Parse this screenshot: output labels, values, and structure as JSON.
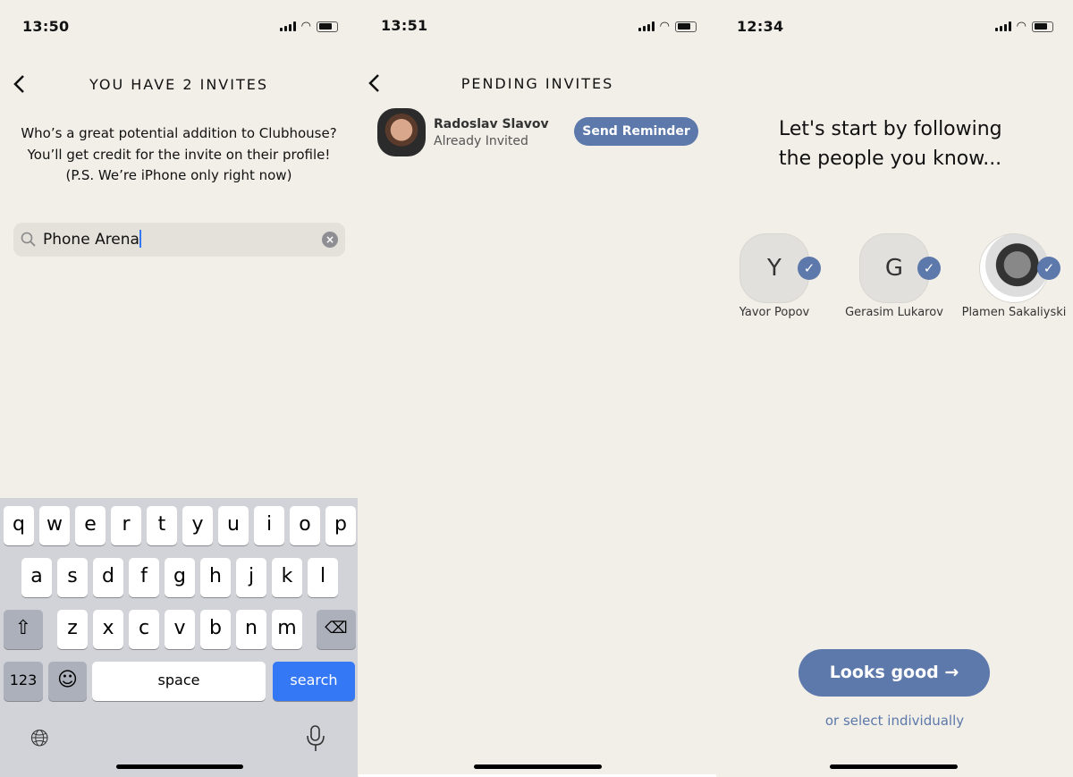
{
  "screen1": {
    "time": "13:50",
    "title": "YOU HAVE 2 INVITES",
    "description": [
      "Who’s a great potential addition to Clubhouse?",
      "You’ll get credit for the invite on their profile!",
      "(P.S. We’re iPhone only right now)"
    ],
    "search_value": "Phone Arena",
    "keyboard": {
      "row1": [
        "q",
        "w",
        "e",
        "r",
        "t",
        "y",
        "u",
        "i",
        "o",
        "p"
      ],
      "row2": [
        "a",
        "s",
        "d",
        "f",
        "g",
        "h",
        "j",
        "k",
        "l"
      ],
      "row3": [
        "z",
        "x",
        "c",
        "v",
        "b",
        "n",
        "m"
      ],
      "numbers": "123",
      "space": "space",
      "search": "search"
    }
  },
  "screen2": {
    "time": "13:51",
    "title": "PENDING INVITES",
    "invite": {
      "name": "Radoslav Slavov",
      "status": "Already Invited",
      "button": "Send Reminder"
    }
  },
  "screen3": {
    "time": "12:34",
    "heading": [
      "Let's start by following",
      "the people you know..."
    ],
    "people": [
      {
        "initial": "Y",
        "name": "Yavor Popov"
      },
      {
        "initial": "G",
        "name": "Gerasim Lukarov"
      },
      {
        "initial": "",
        "name": "Plamen Sakaliyski"
      }
    ],
    "primary_button": "Looks good →",
    "secondary_link": "or select individually"
  },
  "colors": {
    "background": "#f1efe8",
    "accent": "#5d78aa",
    "keyboard": "#d1d3d9",
    "search_key": "#3478f6"
  }
}
